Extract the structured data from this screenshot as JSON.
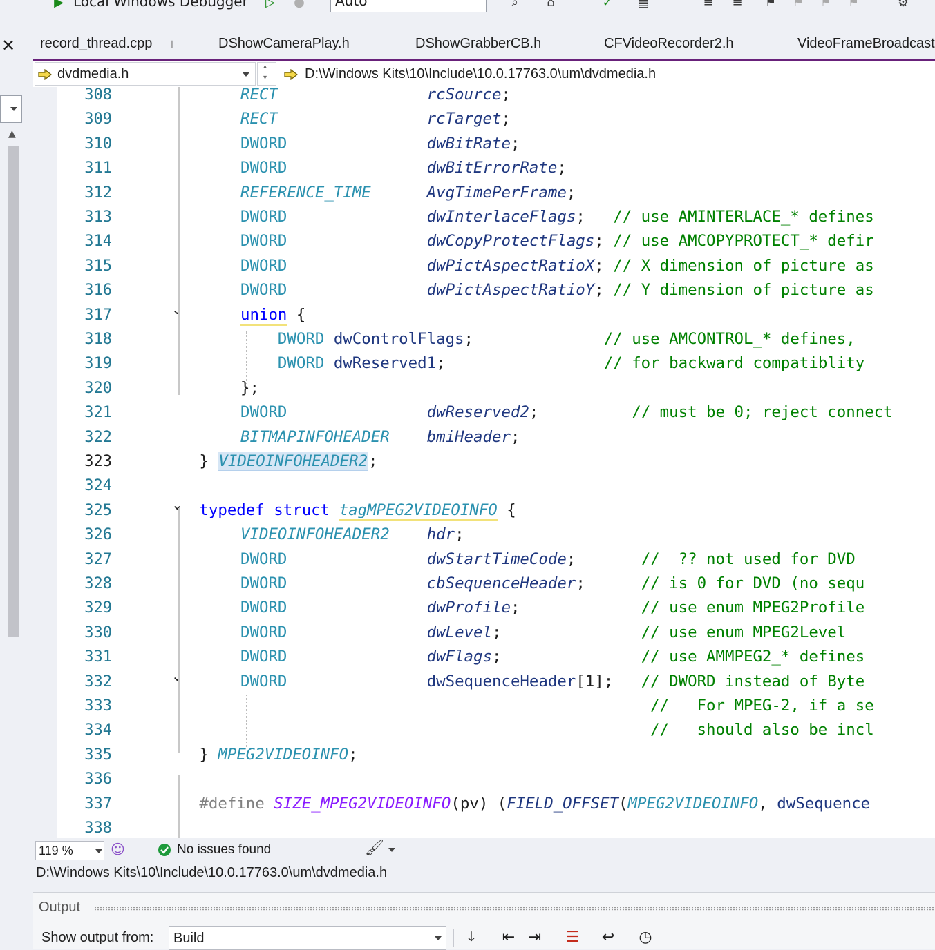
{
  "toolbar": {
    "debugger_label": "Local Windows Debugger",
    "config_value": "Auto"
  },
  "tabs": [
    {
      "label": "record_thread.cpp",
      "pinned": true,
      "active": true
    },
    {
      "label": "DShowCameraPlay.h"
    },
    {
      "label": "DShowGrabberCB.h"
    },
    {
      "label": "CFVideoRecorder2.h"
    },
    {
      "label": "VideoFrameBroadcast"
    }
  ],
  "navbar": {
    "file_scope": "dvdmedia.h",
    "member_path": "D:\\Windows Kits\\10\\Include\\10.0.17763.0\\um\\dvdmedia.h"
  },
  "editor": {
    "current_line": 323,
    "lines": [
      {
        "n": "308",
        "html": "<span class=\"ti\">RECT</span>                <span class=\"fi\">rcSource</span>;"
      },
      {
        "n": "309",
        "html": "<span class=\"ti\">RECT</span>                <span class=\"fi\">rcTarget</span>;"
      },
      {
        "n": "310",
        "html": "<span class=\"t\">DWORD</span>               <span class=\"fi\">dwBitRate</span>;"
      },
      {
        "n": "311",
        "html": "<span class=\"t\">DWORD</span>               <span class=\"fi\">dwBitErrorRate</span>;"
      },
      {
        "n": "312",
        "html": "<span class=\"ti\">REFERENCE_TIME</span>      <span class=\"fi\">AvgTimePerFrame</span>;"
      },
      {
        "n": "313",
        "html": "<span class=\"t\">DWORD</span>               <span class=\"fi\">dwInterlaceFlags</span>;   <span class=\"c\">// use AMINTERLACE_* defines</span>"
      },
      {
        "n": "314",
        "html": "<span class=\"t\">DWORD</span>               <span class=\"fi\">dwCopyProtectFlags</span>; <span class=\"c\">// use AMCOPYPROTECT_* defir</span>"
      },
      {
        "n": "315",
        "html": "<span class=\"t\">DWORD</span>               <span class=\"fi\">dwPictAspectRatioX</span>; <span class=\"c\">// X dimension of picture as</span>"
      },
      {
        "n": "316",
        "html": "<span class=\"t\">DWORD</span>               <span class=\"fi\">dwPictAspectRatioY</span>; <span class=\"c\">// Y dimension of picture as</span>"
      },
      {
        "n": "317",
        "html": "<span class=\"k ul\">union</span> {",
        "fold": true
      },
      {
        "n": "318",
        "html": "    <span class=\"t\">DWORD</span> <span class=\"fn\">dwControlFlags</span>;              <span class=\"c\">// use AMCONTROL_* defines,</span>"
      },
      {
        "n": "319",
        "html": "    <span class=\"t\">DWORD</span> <span class=\"fn\">dwReserved1</span>;                 <span class=\"c\">// for backward compatiblity</span>"
      },
      {
        "n": "320",
        "html": "};"
      },
      {
        "n": "321",
        "html": "<span class=\"t\">DWORD</span>               <span class=\"fi\">dwReserved2</span>;          <span class=\"c\">// must be 0; reject connect</span>"
      },
      {
        "n": "322",
        "html": "<span class=\"ti\">BITMAPINFOHEADER</span>    <span class=\"fi\">bmiHeader</span>;"
      },
      {
        "n": "323",
        "html": "} <span class=\"ti hl\">VIDEOINFOHEADER2</span>;",
        "indent": -4
      },
      {
        "n": "324",
        "html": ""
      },
      {
        "n": "325",
        "html": "<span class=\"k\">typedef</span> <span class=\"k\">struct</span> <span class=\"ti ul\">tagMPEG2VIDEOINFO</span> {",
        "indent": -4,
        "fold": true
      },
      {
        "n": "326",
        "html": "<span class=\"ti\">VIDEOINFOHEADER2</span>    <span class=\"fi\">hdr</span>;"
      },
      {
        "n": "327",
        "html": "<span class=\"t\">DWORD</span>               <span class=\"fi\">dwStartTimeCode</span>;       <span class=\"c\">//  ?? not used for DVD</span>"
      },
      {
        "n": "328",
        "html": "<span class=\"t\">DWORD</span>               <span class=\"fi\">cbSequenceHeader</span>;      <span class=\"c\">// is 0 for DVD (no sequ</span>"
      },
      {
        "n": "329",
        "html": "<span class=\"t\">DWORD</span>               <span class=\"fi\">dwProfile</span>;             <span class=\"c\">// use enum MPEG2Profile</span>"
      },
      {
        "n": "330",
        "html": "<span class=\"t\">DWORD</span>               <span class=\"fi\">dwLevel</span>;               <span class=\"c\">// use enum MPEG2Level</span>"
      },
      {
        "n": "331",
        "html": "<span class=\"t\">DWORD</span>               <span class=\"fi\">dwFlags</span>;               <span class=\"c\">// use AMMPEG2_* defines</span>"
      },
      {
        "n": "332",
        "html": "<span class=\"t\">DWORD</span>               <span class=\"fn\">dwSequenceHeader</span>[1];   <span class=\"c\">// DWORD instead of Byte</span>",
        "fold": true
      },
      {
        "n": "333",
        "html": "                                            <span class=\"c\">//   For MPEG-2, if a se</span>"
      },
      {
        "n": "334",
        "html": "                                            <span class=\"c\">//   should also be incl</span>"
      },
      {
        "n": "335",
        "html": "} <span class=\"ti\">MPEG2VIDEOINFO</span>;",
        "indent": -4
      },
      {
        "n": "336",
        "html": ""
      },
      {
        "n": "337",
        "html": "<span class=\"p\">#define</span> <span class=\"m\">SIZE_MPEG2VIDEOINFO</span>(pv) (<span class=\"m\" style=\"color:#1f377f\">FIELD_OFFSET</span>(<span class=\"ti\">MPEG2VIDEOINFO</span>, <span class=\"fn\">dwSequence</span>",
        "indent": -4
      },
      {
        "n": "338",
        "html": ""
      }
    ]
  },
  "status": {
    "zoom": "119 %",
    "issues": "No issues found",
    "file_path": "D:\\Windows Kits\\10\\Include\\10.0.17763.0\\um\\dvdmedia.h"
  },
  "output": {
    "title": "Output",
    "show_from_label": "Show output from:",
    "source_value": "Build"
  },
  "icons": {
    "success": "check-circle-icon",
    "brand_accent": "#68217a",
    "keyword_color": "#0000ff",
    "type_color": "#2b91af",
    "comment_color": "#008000"
  }
}
